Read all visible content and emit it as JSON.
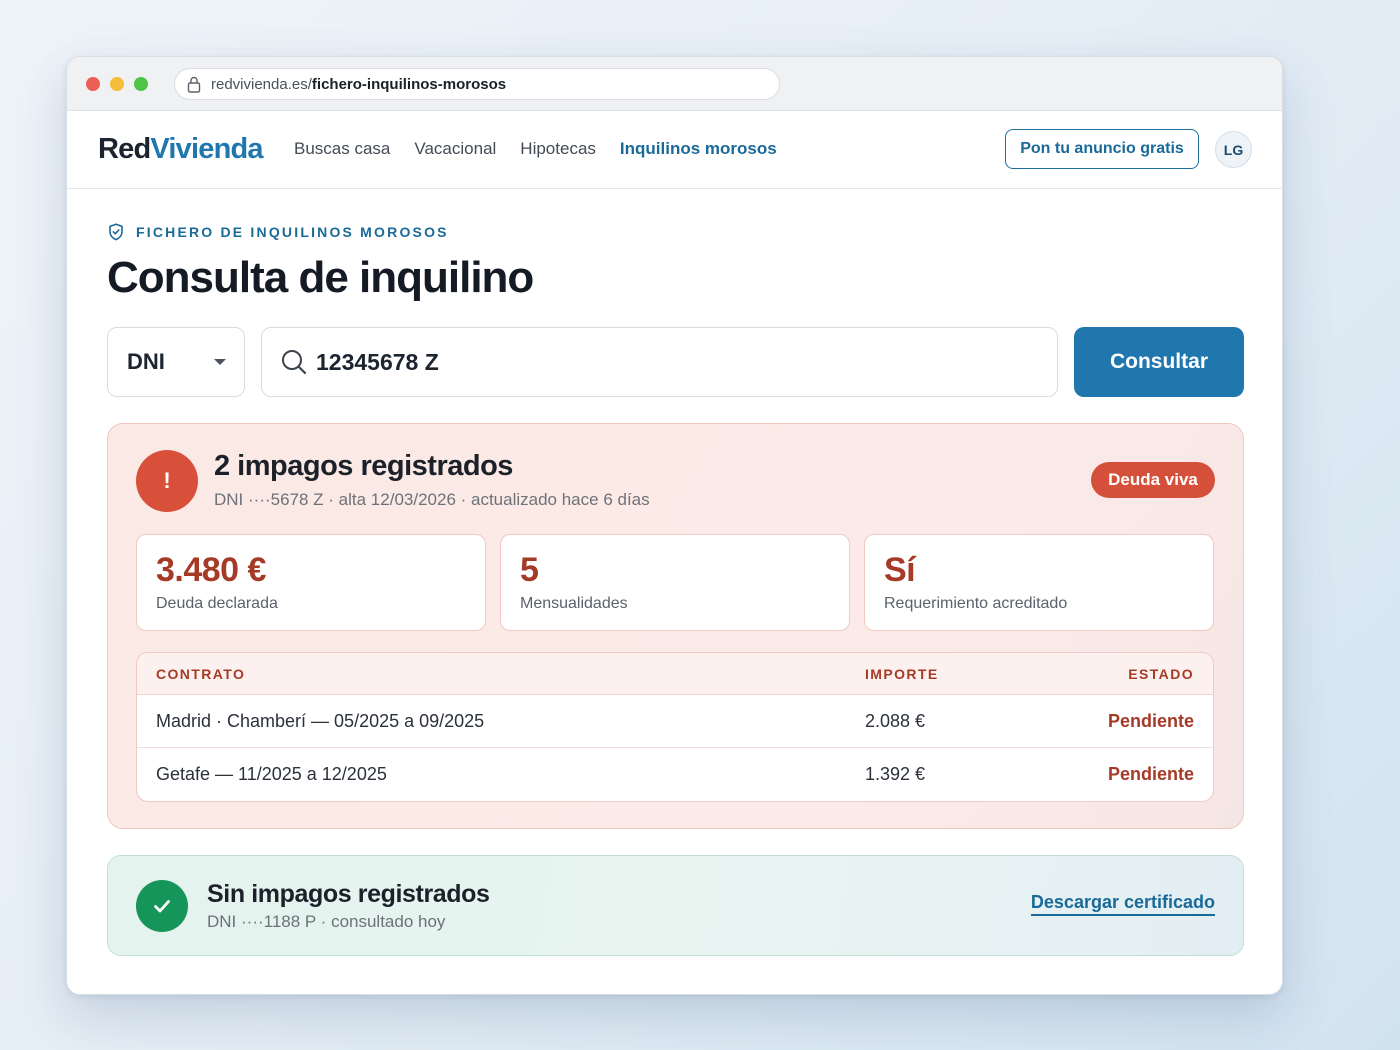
{
  "browser": {
    "url_host": "redvivienda.es/",
    "url_path": "fichero-inquilinos-morosos"
  },
  "header": {
    "logo_part1": "Red",
    "logo_part2": "Vivienda",
    "nav": [
      "Buscas casa",
      "Vacacional",
      "Hipotecas",
      "Inquilinos morosos"
    ],
    "active_nav": "Inquilinos morosos",
    "cta_label": "Pon tu anuncio gratis",
    "avatar_initials": "LG"
  },
  "page": {
    "eyebrow": "FICHERO DE INQUILINOS MOROSOS",
    "title": "Consulta de inquilino"
  },
  "search": {
    "doc_type": "DNI",
    "value": "12345678 Z",
    "button_label": "Consultar"
  },
  "result_alert": {
    "icon": "!",
    "title": "2 impagos registrados",
    "subtitle": "DNI ····5678 Z · alta 12/03/2026 · actualizado hace 6 días",
    "badge": "Deuda viva",
    "stats": [
      {
        "value": "3.480 €",
        "label": "Deuda declarada"
      },
      {
        "value": "5",
        "label": "Mensualidades"
      },
      {
        "value": "Sí",
        "label": "Requerimiento acreditado"
      }
    ],
    "table": {
      "headers": [
        "CONTRATO",
        "IMPORTE",
        "ESTADO"
      ],
      "rows": [
        {
          "contrato": "Madrid · Chamberí — 05/2025 a 09/2025",
          "importe": "2.088 €",
          "estado": "Pendiente"
        },
        {
          "contrato": "Getafe — 11/2025 a 12/2025",
          "importe": "1.392 €",
          "estado": "Pendiente"
        }
      ]
    }
  },
  "result_ok": {
    "title": "Sin impagos registrados",
    "subtitle": "DNI ····1188 P · consultado hoy",
    "link_label": "Descargar certificado"
  },
  "colors": {
    "brand": "#1f77ad",
    "danger": "#d9503a",
    "danger_text": "#a53a26",
    "success": "#15955a"
  }
}
